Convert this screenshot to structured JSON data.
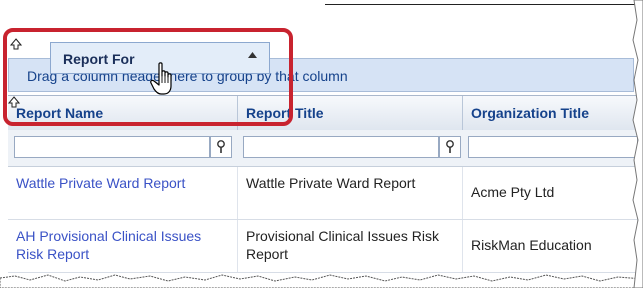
{
  "group_panel": {
    "text": "Drag a column header here to group by that column"
  },
  "drag_ghost": {
    "label": "Report For"
  },
  "columns": [
    {
      "label": "Report Name"
    },
    {
      "label": "Report Title"
    },
    {
      "label": "Organization Title"
    }
  ],
  "rows": [
    {
      "report_name": "Wattle Private Ward Report",
      "report_title": "Wattle Private Ward Report",
      "organization_title": "Acme Pty Ltd"
    },
    {
      "report_name": "AH Provisional Clinical Issues Risk Report",
      "report_title": "Provisional Clinical Issues Risk Report",
      "organization_title": "RiskMan Education"
    }
  ],
  "icons": {
    "filter": "filter-funnel-icon",
    "sort_up": "caret-up-icon",
    "drop_arrow": "drop-indicator-arrow-icon",
    "cursor": "hand-pointer-icon"
  },
  "colors": {
    "header_text": "#15428b",
    "link": "#3a52c6",
    "highlight": "#c8232f",
    "group_panel_bg": "#d6e3f5"
  }
}
